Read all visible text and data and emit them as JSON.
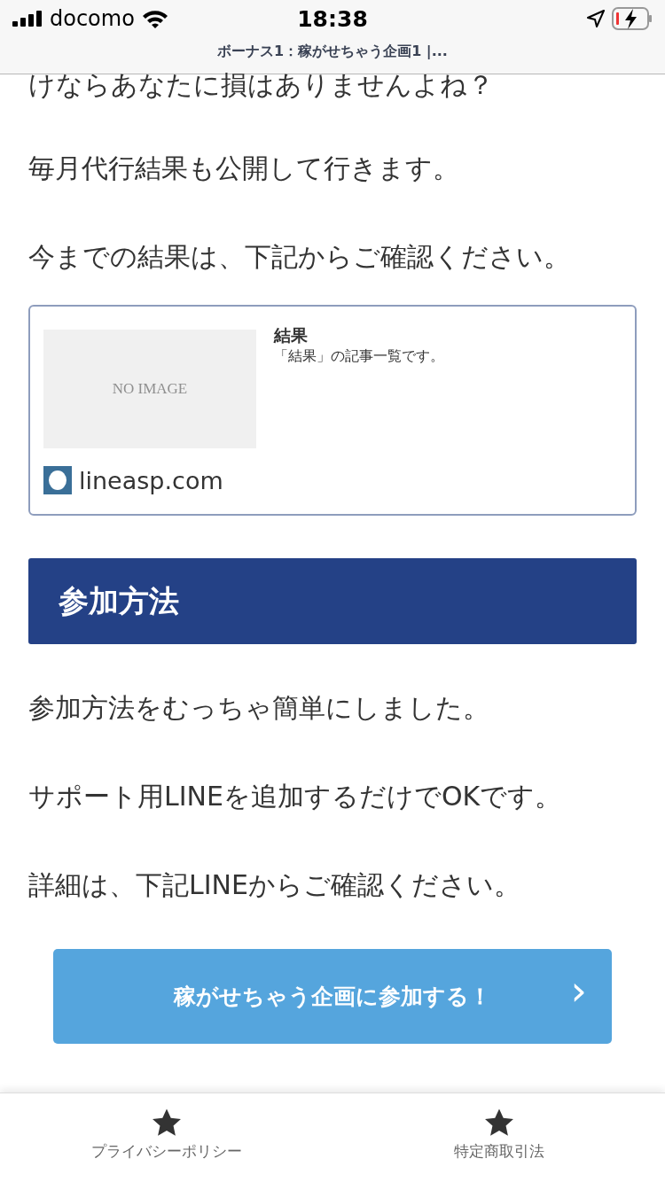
{
  "status_bar": {
    "carrier": "docomo",
    "time": "18:38"
  },
  "url_bar": {
    "title": "ボーナス1：稼がせちゃう企画1 |..."
  },
  "paragraphs_top": [
    "けならあなたに損はありませんよね？",
    "毎月代行結果も公開して行きます。",
    "今までの結果は、下記からご確認ください。"
  ],
  "link_card": {
    "thumbnail_text": "NO IMAGE",
    "title": "結果",
    "description": "「結果」の記事一覧です。",
    "site": "lineasp.com"
  },
  "section_heading": "参加方法",
  "paragraphs_bottom": [
    "参加方法をむっちゃ簡単にしました。",
    "サポート用LINEを追加するだけでOKです。",
    "詳細は、下記LINEからご確認ください。"
  ],
  "cta_button": {
    "label": "稼がせちゃう企画に参加する！",
    "arrow": "›"
  },
  "footer_nav": [
    {
      "label": "プライバシーポリシー"
    },
    {
      "label": "特定商取引法"
    }
  ]
}
